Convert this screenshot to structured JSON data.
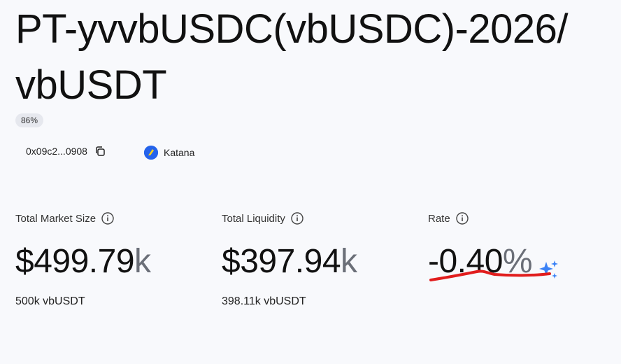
{
  "header": {
    "title": "PT-yvvbUSDC(vbUSDC)-2026/ vbUSDT",
    "badge": "86%",
    "address": "0x09c2...0908",
    "chain": "Katana"
  },
  "stats": [
    {
      "label": "Total Market Size",
      "value": "$499.79",
      "unit": "k",
      "sub": "500k vbUSDT"
    },
    {
      "label": "Total Liquidity",
      "value": "$397.94",
      "unit": "k",
      "sub": "398.11k vbUSDT"
    },
    {
      "label": "Rate",
      "value": "-0.40",
      "unit": "%",
      "sub": ""
    }
  ],
  "colors": {
    "sparkle": "#3b82f6",
    "annotation": "#e11d1d"
  }
}
